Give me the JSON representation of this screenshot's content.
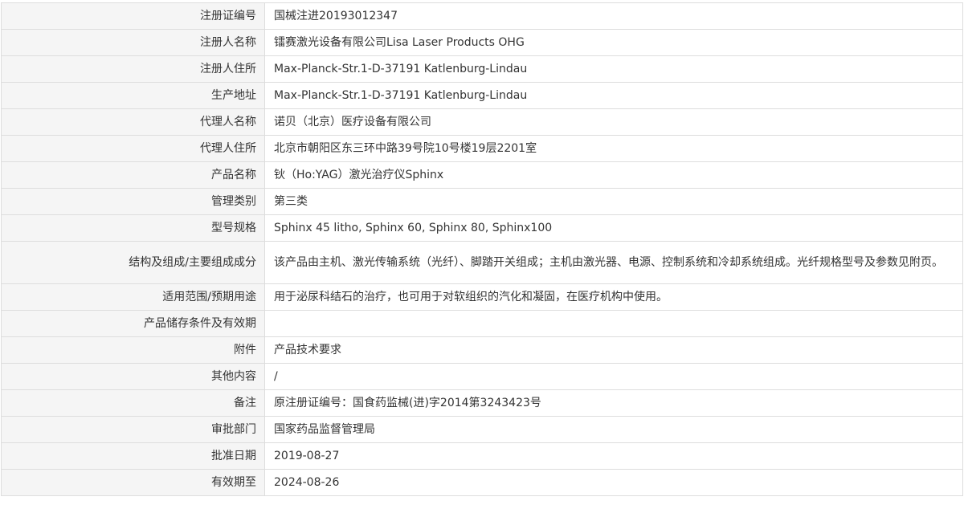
{
  "rows": [
    {
      "label": "注册证编号",
      "value": "国械注进20193012347"
    },
    {
      "label": "注册人名称",
      "value": "镭赛激光设备有限公司Lisa Laser Products OHG"
    },
    {
      "label": "注册人住所",
      "value": "Max-Planck-Str.1-D-37191 Katlenburg-Lindau"
    },
    {
      "label": "生产地址",
      "value": "Max-Planck-Str.1-D-37191 Katlenburg-Lindau"
    },
    {
      "label": "代理人名称",
      "value": "诺贝（北京）医疗设备有限公司"
    },
    {
      "label": "代理人住所",
      "value": "北京市朝阳区东三环中路39号院10号楼19层2201室"
    },
    {
      "label": "产品名称",
      "value": "钬（Ho:YAG）激光治疗仪Sphinx"
    },
    {
      "label": "管理类别",
      "value": "第三类"
    },
    {
      "label": "型号规格",
      "value": "Sphinx 45 litho, Sphinx 60, Sphinx 80, Sphinx100"
    },
    {
      "label": "结构及组成/主要组成成分",
      "value": "该产品由主机、激光传输系统（光纤）、脚踏开关组成；主机由激光器、电源、控制系统和冷却系统组成。光纤规格型号及参数见附页。"
    },
    {
      "label": "适用范围/预期用途",
      "value": "用于泌尿科结石的治疗，也可用于对软组织的汽化和凝固，在医疗机构中使用。"
    },
    {
      "label": "产品储存条件及有效期",
      "value": ""
    },
    {
      "label": "附件",
      "value": "产品技术要求"
    },
    {
      "label": "其他内容",
      "value": "/"
    },
    {
      "label": "备注",
      "value": "原注册证编号：国食药监械(进)字2014第3243423号"
    },
    {
      "label": "审批部门",
      "value": "国家药品监督管理局"
    },
    {
      "label": "批准日期",
      "value": "2019-08-27"
    },
    {
      "label": "有效期至",
      "value": "2024-08-26"
    }
  ]
}
